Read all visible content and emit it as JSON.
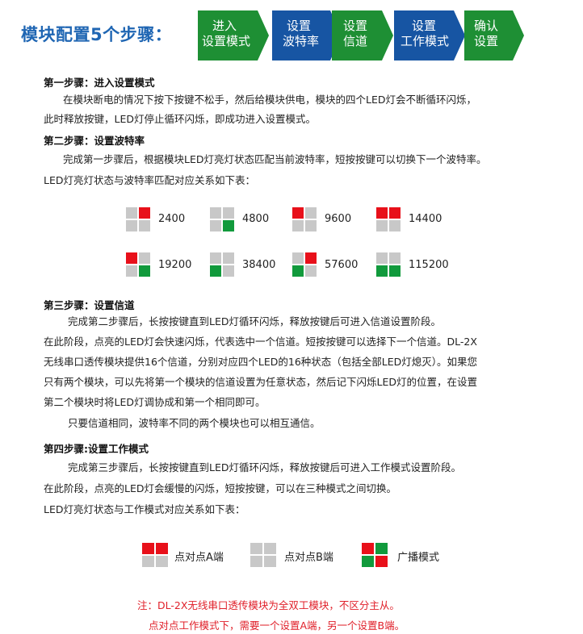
{
  "header": {
    "title": "模块配置5个步骤：",
    "steps": [
      {
        "line1": "进入",
        "line2": "设置模式",
        "color": "#1e8f34"
      },
      {
        "line1": "设置",
        "line2": "波特率",
        "color": "#1755a3"
      },
      {
        "line1": "设置",
        "line2": "信道",
        "color": "#1e8f34"
      },
      {
        "line1": "设置",
        "line2": "工作模式",
        "color": "#1755a3"
      },
      {
        "line1": "确认",
        "line2": "设置",
        "color": "#1e8f34"
      }
    ]
  },
  "colors": {
    "red": "#e8101a",
    "green": "#119a3c",
    "gray": "#c8c8c8",
    "accent": "#1f66b3"
  },
  "step1": {
    "heading": "第一步骤：进入设置模式",
    "line1": "在模块断电的情况下按下按键不松手，然后给模块供电，模块的四个LED灯会不断循环闪烁，",
    "line2": "此时释放按键，LED灯停止循环闪烁，即成功进入设置模式。"
  },
  "step2": {
    "heading": "第二步骤：设置波特率",
    "line1": "完成第一步骤后，根据模块LED灯亮灯状态匹配当前波特率，短按按键可以切换下一个波特率。",
    "line2": "LED灯亮灯状态与波特率匹配对应关系如下表：",
    "baud": [
      {
        "label": "2400",
        "leds": [
          "gray",
          "red",
          "gray",
          "gray"
        ]
      },
      {
        "label": "4800",
        "leds": [
          "gray",
          "gray",
          "gray",
          "green"
        ]
      },
      {
        "label": "9600",
        "leds": [
          "red",
          "gray",
          "gray",
          "gray"
        ]
      },
      {
        "label": "14400",
        "leds": [
          "red",
          "red",
          "gray",
          "gray"
        ]
      },
      {
        "label": "19200",
        "leds": [
          "red",
          "gray",
          "gray",
          "green"
        ]
      },
      {
        "label": "38400",
        "leds": [
          "gray",
          "gray",
          "green",
          "gray"
        ]
      },
      {
        "label": "57600",
        "leds": [
          "gray",
          "red",
          "green",
          "gray"
        ]
      },
      {
        "label": "115200",
        "leds": [
          "gray",
          "gray",
          "green",
          "green"
        ]
      }
    ]
  },
  "step3": {
    "heading": "第三步骤：设置信道",
    "line1": "完成第二步骤后，长按按键直到LED灯循环闪烁，释放按键后可进入信道设置阶段。",
    "line2": "在此阶段，点亮的LED灯会快速闪烁，代表选中一个信道。短按按键可以选择下一个信道。DL-2X",
    "line3": "无线串口透传模块提供16个信道，分别对应四个LED的16种状态（包括全部LED灯熄灭）。如果您",
    "line4": "只有两个模块，可以先将第一个模块的信道设置为任意状态，然后记下闪烁LED灯的位置，在设置",
    "line5": "第二个模块时将LED灯调协成和第一个相同即可。",
    "line6": "只要信道相同，波特率不同的两个模块也可以相互通信。"
  },
  "step4": {
    "heading": "第四步骤:设置工作模式",
    "line1": "完成第三步骤后，长按按键直到LED灯循环闪烁，释放按键后可进入工作模式设置阶段。",
    "line2": "在此阶段，点亮的LED灯会缓慢的闪烁，短按按键，可以在三种模式之间切换。",
    "line3": "LED灯亮灯状态与工作模式对应关系如下表：",
    "modes": [
      {
        "label": "点对点A端",
        "leds": [
          "red",
          "red",
          "gray",
          "gray"
        ]
      },
      {
        "label": "点对点B端",
        "leds": [
          "gray",
          "gray",
          "gray",
          "gray"
        ]
      },
      {
        "label": "广播模式",
        "leds": [
          "red",
          "green",
          "green",
          "red"
        ]
      }
    ]
  },
  "note": {
    "line1": "注：DL-2X无线串口透传模块为全双工模块，不区分主从。",
    "line2": "点对点工作模式下，需要一个设置A端，另一个设置B端。"
  }
}
